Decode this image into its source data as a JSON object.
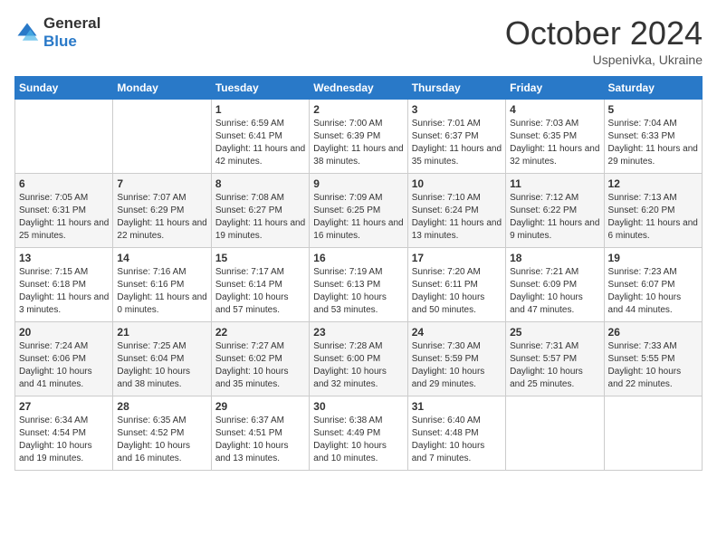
{
  "logo": {
    "general": "General",
    "blue": "Blue"
  },
  "title": "October 2024",
  "location": "Uspenivka, Ukraine",
  "days_of_week": [
    "Sunday",
    "Monday",
    "Tuesday",
    "Wednesday",
    "Thursday",
    "Friday",
    "Saturday"
  ],
  "weeks": [
    [
      {
        "day": "",
        "info": ""
      },
      {
        "day": "",
        "info": ""
      },
      {
        "day": "1",
        "info": "Sunrise: 6:59 AM\nSunset: 6:41 PM\nDaylight: 11 hours and 42 minutes."
      },
      {
        "day": "2",
        "info": "Sunrise: 7:00 AM\nSunset: 6:39 PM\nDaylight: 11 hours and 38 minutes."
      },
      {
        "day": "3",
        "info": "Sunrise: 7:01 AM\nSunset: 6:37 PM\nDaylight: 11 hours and 35 minutes."
      },
      {
        "day": "4",
        "info": "Sunrise: 7:03 AM\nSunset: 6:35 PM\nDaylight: 11 hours and 32 minutes."
      },
      {
        "day": "5",
        "info": "Sunrise: 7:04 AM\nSunset: 6:33 PM\nDaylight: 11 hours and 29 minutes."
      }
    ],
    [
      {
        "day": "6",
        "info": "Sunrise: 7:05 AM\nSunset: 6:31 PM\nDaylight: 11 hours and 25 minutes."
      },
      {
        "day": "7",
        "info": "Sunrise: 7:07 AM\nSunset: 6:29 PM\nDaylight: 11 hours and 22 minutes."
      },
      {
        "day": "8",
        "info": "Sunrise: 7:08 AM\nSunset: 6:27 PM\nDaylight: 11 hours and 19 minutes."
      },
      {
        "day": "9",
        "info": "Sunrise: 7:09 AM\nSunset: 6:25 PM\nDaylight: 11 hours and 16 minutes."
      },
      {
        "day": "10",
        "info": "Sunrise: 7:10 AM\nSunset: 6:24 PM\nDaylight: 11 hours and 13 minutes."
      },
      {
        "day": "11",
        "info": "Sunrise: 7:12 AM\nSunset: 6:22 PM\nDaylight: 11 hours and 9 minutes."
      },
      {
        "day": "12",
        "info": "Sunrise: 7:13 AM\nSunset: 6:20 PM\nDaylight: 11 hours and 6 minutes."
      }
    ],
    [
      {
        "day": "13",
        "info": "Sunrise: 7:15 AM\nSunset: 6:18 PM\nDaylight: 11 hours and 3 minutes."
      },
      {
        "day": "14",
        "info": "Sunrise: 7:16 AM\nSunset: 6:16 PM\nDaylight: 11 hours and 0 minutes."
      },
      {
        "day": "15",
        "info": "Sunrise: 7:17 AM\nSunset: 6:14 PM\nDaylight: 10 hours and 57 minutes."
      },
      {
        "day": "16",
        "info": "Sunrise: 7:19 AM\nSunset: 6:13 PM\nDaylight: 10 hours and 53 minutes."
      },
      {
        "day": "17",
        "info": "Sunrise: 7:20 AM\nSunset: 6:11 PM\nDaylight: 10 hours and 50 minutes."
      },
      {
        "day": "18",
        "info": "Sunrise: 7:21 AM\nSunset: 6:09 PM\nDaylight: 10 hours and 47 minutes."
      },
      {
        "day": "19",
        "info": "Sunrise: 7:23 AM\nSunset: 6:07 PM\nDaylight: 10 hours and 44 minutes."
      }
    ],
    [
      {
        "day": "20",
        "info": "Sunrise: 7:24 AM\nSunset: 6:06 PM\nDaylight: 10 hours and 41 minutes."
      },
      {
        "day": "21",
        "info": "Sunrise: 7:25 AM\nSunset: 6:04 PM\nDaylight: 10 hours and 38 minutes."
      },
      {
        "day": "22",
        "info": "Sunrise: 7:27 AM\nSunset: 6:02 PM\nDaylight: 10 hours and 35 minutes."
      },
      {
        "day": "23",
        "info": "Sunrise: 7:28 AM\nSunset: 6:00 PM\nDaylight: 10 hours and 32 minutes."
      },
      {
        "day": "24",
        "info": "Sunrise: 7:30 AM\nSunset: 5:59 PM\nDaylight: 10 hours and 29 minutes."
      },
      {
        "day": "25",
        "info": "Sunrise: 7:31 AM\nSunset: 5:57 PM\nDaylight: 10 hours and 25 minutes."
      },
      {
        "day": "26",
        "info": "Sunrise: 7:33 AM\nSunset: 5:55 PM\nDaylight: 10 hours and 22 minutes."
      }
    ],
    [
      {
        "day": "27",
        "info": "Sunrise: 6:34 AM\nSunset: 4:54 PM\nDaylight: 10 hours and 19 minutes."
      },
      {
        "day": "28",
        "info": "Sunrise: 6:35 AM\nSunset: 4:52 PM\nDaylight: 10 hours and 16 minutes."
      },
      {
        "day": "29",
        "info": "Sunrise: 6:37 AM\nSunset: 4:51 PM\nDaylight: 10 hours and 13 minutes."
      },
      {
        "day": "30",
        "info": "Sunrise: 6:38 AM\nSunset: 4:49 PM\nDaylight: 10 hours and 10 minutes."
      },
      {
        "day": "31",
        "info": "Sunrise: 6:40 AM\nSunset: 4:48 PM\nDaylight: 10 hours and 7 minutes."
      },
      {
        "day": "",
        "info": ""
      },
      {
        "day": "",
        "info": ""
      }
    ]
  ]
}
